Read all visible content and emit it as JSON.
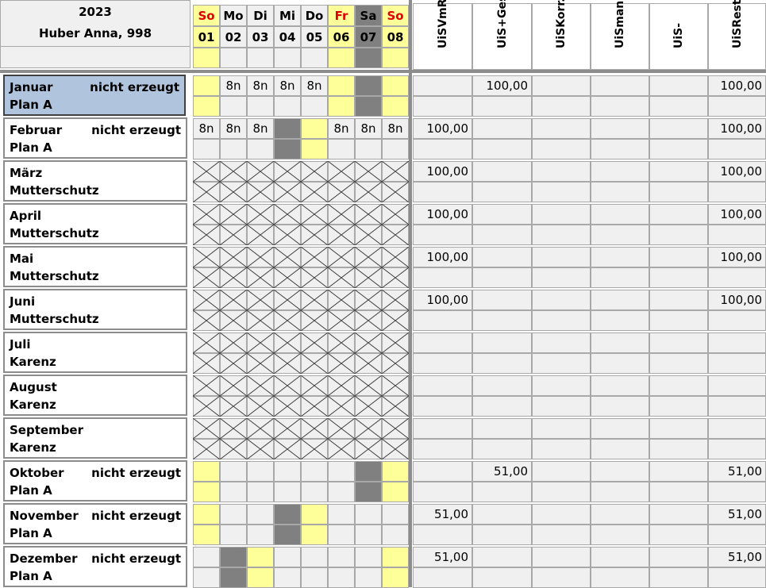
{
  "header": {
    "year": "2023",
    "person": "Huber Anna, 998",
    "days": [
      {
        "dow": "So",
        "num": "01",
        "type": "sun"
      },
      {
        "dow": "Mo",
        "num": "02",
        "type": "work"
      },
      {
        "dow": "Di",
        "num": "03",
        "type": "work"
      },
      {
        "dow": "Mi",
        "num": "04",
        "type": "work"
      },
      {
        "dow": "Do",
        "num": "05",
        "type": "work"
      },
      {
        "dow": "Fr",
        "num": "06",
        "type": "holiday"
      },
      {
        "dow": "Sa",
        "num": "07",
        "type": "sat"
      },
      {
        "dow": "So",
        "num": "08",
        "type": "sun"
      }
    ],
    "day_row3": [
      "y",
      "",
      "",
      "",
      "",
      "y",
      "g",
      "y"
    ],
    "value_columns": [
      "UiSVmRe",
      "UiS+Ges",
      "UiSKorr.",
      "UiSman",
      "UiS-",
      "UiSRest"
    ]
  },
  "months": [
    {
      "name": "Januar",
      "status": "nicht erzeugt",
      "plan": "Plan A",
      "selected": true,
      "row1": [
        {
          "c": "y"
        },
        {
          "t": "8n"
        },
        {
          "t": "8n"
        },
        {
          "t": "8n"
        },
        {
          "t": "8n"
        },
        {
          "c": "y"
        },
        {
          "c": "g"
        },
        {
          "c": "y"
        }
      ],
      "row2": [
        {
          "c": "y"
        },
        {},
        {},
        {},
        {},
        {
          "c": "y"
        },
        {
          "c": "g"
        },
        {
          "c": "y"
        }
      ],
      "values": [
        "",
        "100,00",
        "",
        "",
        "",
        "100,00"
      ]
    },
    {
      "name": "Februar",
      "status": "nicht erzeugt",
      "plan": "Plan A",
      "row1": [
        {
          "t": "8n"
        },
        {
          "t": "8n"
        },
        {
          "t": "8n"
        },
        {
          "c": "g"
        },
        {
          "c": "y"
        },
        {
          "t": "8n"
        },
        {
          "t": "8n"
        },
        {
          "t": "8n"
        }
      ],
      "row2": [
        {},
        {},
        {},
        {
          "c": "g"
        },
        {
          "c": "y"
        },
        {},
        {},
        {}
      ],
      "values": [
        "100,00",
        "",
        "",
        "",
        "",
        "100,00"
      ]
    },
    {
      "name": "März",
      "status": "",
      "plan": "Mutterschutz",
      "crossed": true,
      "values": [
        "100,00",
        "",
        "",
        "",
        "",
        "100,00"
      ]
    },
    {
      "name": "April",
      "status": "",
      "plan": "Mutterschutz",
      "crossed": true,
      "values": [
        "100,00",
        "",
        "",
        "",
        "",
        "100,00"
      ]
    },
    {
      "name": "Mai",
      "status": "",
      "plan": "Mutterschutz",
      "crossed": true,
      "values": [
        "100,00",
        "",
        "",
        "",
        "",
        "100,00"
      ]
    },
    {
      "name": "Juni",
      "status": "",
      "plan": "Mutterschutz",
      "crossed": true,
      "values": [
        "100,00",
        "",
        "",
        "",
        "",
        "100,00"
      ]
    },
    {
      "name": "Juli",
      "status": "",
      "plan": "Karenz",
      "crossed": true,
      "values": [
        "",
        "",
        "",
        "",
        "",
        ""
      ]
    },
    {
      "name": "August",
      "status": "",
      "plan": "Karenz",
      "crossed": true,
      "values": [
        "",
        "",
        "",
        "",
        "",
        ""
      ]
    },
    {
      "name": "September",
      "status": "",
      "plan": "Karenz",
      "crossed": true,
      "values": [
        "",
        "",
        "",
        "",
        "",
        ""
      ]
    },
    {
      "name": "Oktober",
      "status": "nicht erzeugt",
      "plan": "Plan A",
      "row1": [
        {
          "c": "y"
        },
        {},
        {},
        {},
        {},
        {},
        {
          "c": "g"
        },
        {
          "c": "y"
        }
      ],
      "row2": [
        {
          "c": "y"
        },
        {},
        {},
        {},
        {},
        {},
        {
          "c": "g"
        },
        {
          "c": "y"
        }
      ],
      "values": [
        "",
        "51,00",
        "",
        "",
        "",
        "51,00"
      ]
    },
    {
      "name": "November",
      "status": "nicht erzeugt",
      "plan": "Plan A",
      "row1": [
        {
          "c": "y"
        },
        {},
        {},
        {
          "c": "g"
        },
        {
          "c": "y"
        },
        {},
        {},
        {}
      ],
      "row2": [
        {
          "c": "y"
        },
        {},
        {},
        {
          "c": "g"
        },
        {
          "c": "y"
        },
        {},
        {},
        {}
      ],
      "values": [
        "51,00",
        "",
        "",
        "",
        "",
        "51,00"
      ]
    },
    {
      "name": "Dezember",
      "status": "nicht erzeugt",
      "plan": "Plan A",
      "row1": [
        {},
        {
          "c": "g"
        },
        {
          "c": "y"
        },
        {},
        {},
        {},
        {},
        {
          "c": "y"
        }
      ],
      "row2": [
        {},
        {
          "c": "g"
        },
        {
          "c": "y"
        },
        {},
        {},
        {},
        {},
        {
          "c": "y"
        }
      ],
      "values": [
        "51,00",
        "",
        "",
        "",
        "",
        "51,00"
      ]
    }
  ]
}
